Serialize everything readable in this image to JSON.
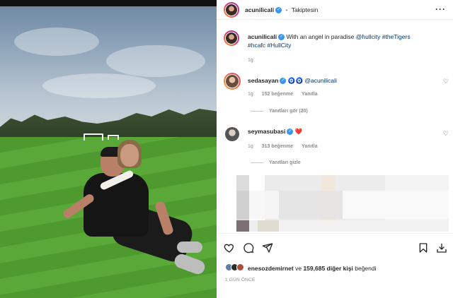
{
  "post": {
    "author": "acunilicali",
    "follow_status": "Takiptesin",
    "more_icon": "more-horizontal-icon",
    "caption_author": "acunilicali",
    "caption_text": "With an angel in paradise",
    "caption_tags_line1": "@hullcity #theTigers",
    "caption_tags_line2": "#hcafc #HullCity",
    "caption_time": "1g"
  },
  "comments": [
    {
      "user": "sedasayan",
      "emoji": "🧿🧿",
      "text": "@acunilicali",
      "time": "1g",
      "likes": "152 beğenme",
      "reply_label": "Yanıtla",
      "replies_label": "Yanıtları gör (20)"
    },
    {
      "user": "seymasubasi",
      "emoji": "❤️",
      "time": "1g",
      "likes": "313 beğenme",
      "reply_label": "Yanıtla",
      "replies_label": "Yanıtları gizle"
    }
  ],
  "actions": {
    "like_icon": "heart-icon",
    "comment_icon": "comment-icon",
    "share_icon": "send-icon",
    "save_icon": "bookmark-icon",
    "download_icon": "download-icon"
  },
  "likes_line": {
    "user": "enesozdemirnet",
    "connector": "ve",
    "count_text": "159,685 diğer kişi",
    "suffix": "beğendi"
  },
  "timestamp": "1 GÜN ÖNCE",
  "colors": {
    "verified": "#3897f0",
    "link": "#00376b",
    "muted": "#8e8e8e",
    "heart_red": "#e0245e"
  }
}
